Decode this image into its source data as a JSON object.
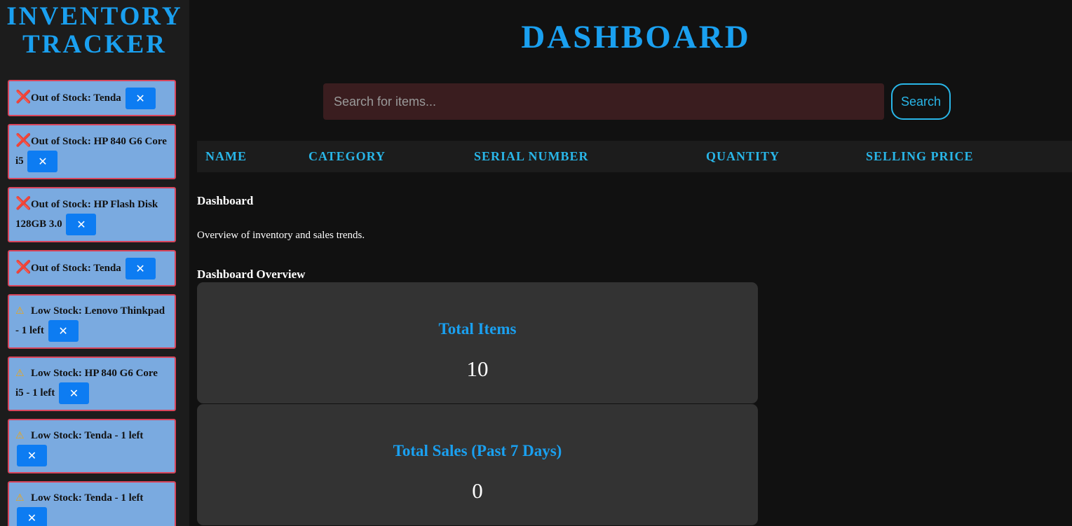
{
  "app": {
    "title_line1": "INVENTORY",
    "title_line2": "TRACKER"
  },
  "alerts": [
    {
      "icon": "cross-icon",
      "text": "Out of Stock: Tenda"
    },
    {
      "icon": "cross-icon",
      "text": "Out of Stock: HP 840 G6 Core i5"
    },
    {
      "icon": "cross-icon",
      "text": "Out of Stock: HP Flash Disk 128GB 3.0"
    },
    {
      "icon": "cross-icon",
      "text": "Out of Stock: Tenda"
    },
    {
      "icon": "warning-icon",
      "text": "Low Stock: Lenovo Thinkpad - 1 left"
    },
    {
      "icon": "warning-icon",
      "text": "Low Stock: HP 840 G6 Core i5 - 1 left"
    },
    {
      "icon": "warning-icon",
      "text": "Low Stock: Tenda - 1 left"
    },
    {
      "icon": "warning-icon",
      "text": "Low Stock: Tenda - 1 left"
    }
  ],
  "dismiss_label": "✕",
  "header": {
    "title": "DASHBOARD"
  },
  "search": {
    "placeholder": "Search for items...",
    "button_label": "Search"
  },
  "table": {
    "columns": [
      "NAME",
      "CATEGORY",
      "SERIAL NUMBER",
      "QUANTITY",
      "SELLING PRICE"
    ]
  },
  "section": {
    "title": "Dashboard",
    "description": "Overview of inventory and sales trends.",
    "overview_title": "Dashboard Overview"
  },
  "cards": [
    {
      "label": "Total Items",
      "value": "10"
    },
    {
      "label": "Total Sales (Past 7 Days)",
      "value": "0"
    }
  ],
  "colors": {
    "accent": "#1aa0f0",
    "alert_bg": "#7aaae0",
    "alert_border": "#d8455c",
    "button": "#0d7cf2"
  }
}
